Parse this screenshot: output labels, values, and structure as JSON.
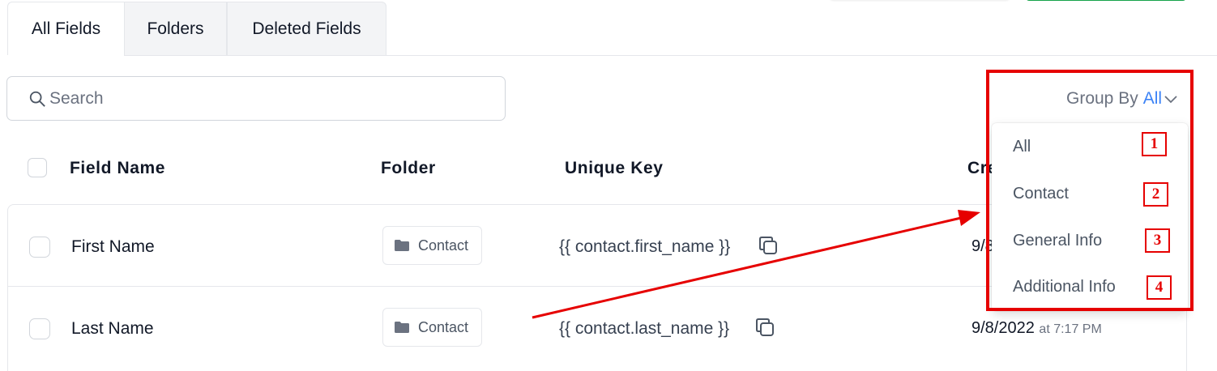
{
  "tabs": [
    {
      "label": "All Fields",
      "active": true
    },
    {
      "label": "Folders",
      "active": false
    },
    {
      "label": "Deleted Fields",
      "active": false
    }
  ],
  "search": {
    "placeholder": "Search",
    "value": ""
  },
  "table": {
    "headers": {
      "field_name": "Field Name",
      "folder": "Folder",
      "unique_key": "Unique Key",
      "created": "Cre"
    },
    "rows": [
      {
        "name": "First Name",
        "folder": "Contact",
        "unique_key": "{{ contact.first_name }}",
        "date": "9/8",
        "time": ""
      },
      {
        "name": "Last Name",
        "folder": "Contact",
        "unique_key": "{{ contact.last_name }}",
        "date": "9/8/2022",
        "time": "at 7:17 PM"
      }
    ]
  },
  "group_by": {
    "label": "Group By",
    "value": "All",
    "options": [
      "All",
      "Contact",
      "General Info",
      "Additional Info"
    ]
  },
  "annotations": {
    "numbers": [
      "1",
      "2",
      "3",
      "4"
    ],
    "color": "#e60000"
  },
  "colors": {
    "accent": "#3b82f6",
    "primary_button": "#16a34a"
  }
}
